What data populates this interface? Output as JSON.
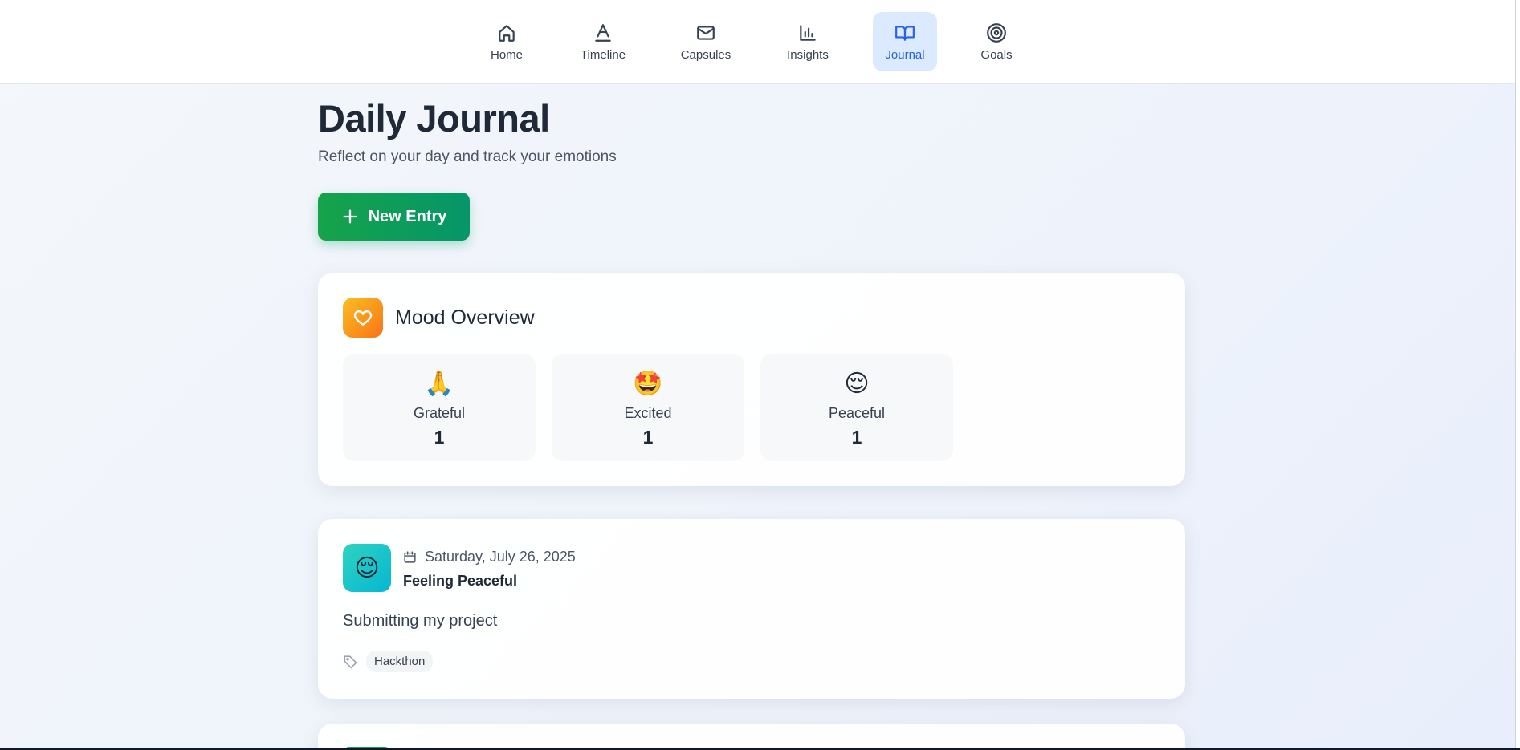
{
  "nav": {
    "items": [
      {
        "label": "Home",
        "icon": "home-icon"
      },
      {
        "label": "Timeline",
        "icon": "timeline-icon"
      },
      {
        "label": "Capsules",
        "icon": "mail-icon"
      },
      {
        "label": "Insights",
        "icon": "bar-chart-icon"
      },
      {
        "label": "Journal",
        "icon": "book-open-icon",
        "active": true
      },
      {
        "label": "Goals",
        "icon": "target-icon"
      }
    ],
    "active_color": "#2563eb",
    "active_bg": "#dbeafe"
  },
  "header": {
    "title": "Daily Journal",
    "subtitle": "Reflect on your day and track your emotions"
  },
  "actions": {
    "new_entry_label": "New Entry",
    "new_entry_icon": "plus-icon"
  },
  "mood_overview": {
    "title": "Mood Overview",
    "icon": "heart-icon",
    "moods": [
      {
        "emoji": "🙏",
        "name": "Grateful",
        "count": "1"
      },
      {
        "emoji": "🤩",
        "name": "Excited",
        "count": "1"
      },
      {
        "emoji": "😌",
        "name": "Peaceful",
        "count": "1"
      }
    ]
  },
  "entries": [
    {
      "emoji": "😌",
      "date": "Saturday, July 26, 2025",
      "mood_label": "Feeling Peaceful",
      "text": "Submitting my project",
      "tags": [
        "Hackthon"
      ]
    }
  ],
  "colors": {
    "primary_green": "#16a34a",
    "heart_orange": "#f97316",
    "peaceful_teal": "#2dd4bf"
  }
}
